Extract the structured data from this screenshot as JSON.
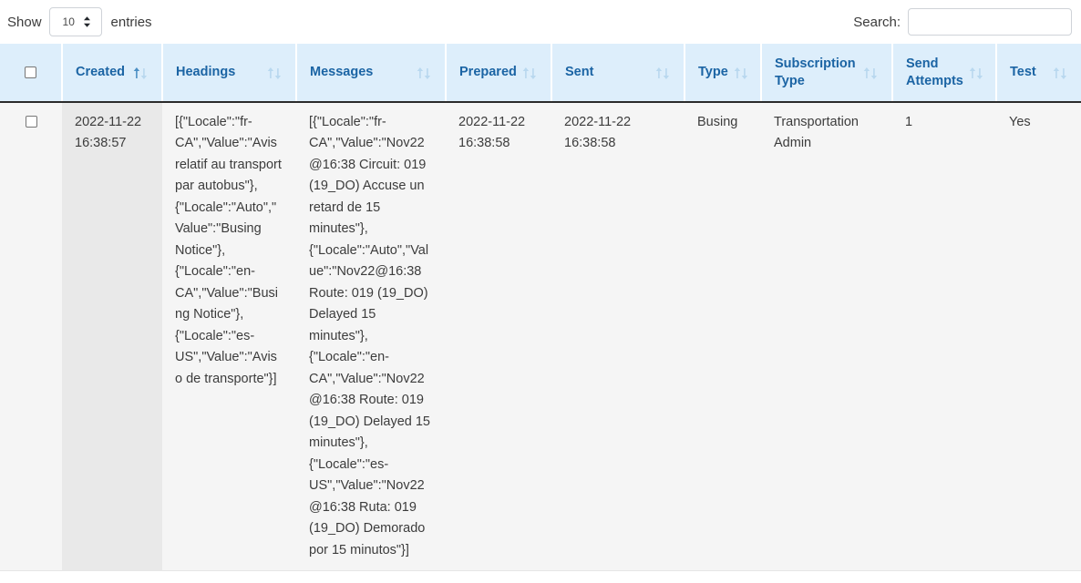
{
  "controls": {
    "show_label": "Show",
    "entries_label": "entries",
    "page_length": "10",
    "page_length_options": [
      "10",
      "25",
      "50",
      "100"
    ],
    "search_label": "Search:",
    "search_value": "",
    "search_placeholder": ""
  },
  "table": {
    "columns": [
      {
        "key": "select",
        "label": "",
        "sortable": false,
        "sorted": false
      },
      {
        "key": "created",
        "label": "Created",
        "sortable": true,
        "sorted": true
      },
      {
        "key": "headings",
        "label": "Headings",
        "sortable": true,
        "sorted": false
      },
      {
        "key": "messages",
        "label": "Messages",
        "sortable": true,
        "sorted": false
      },
      {
        "key": "prepared",
        "label": "Prepared",
        "sortable": true,
        "sorted": false
      },
      {
        "key": "sent",
        "label": "Sent",
        "sortable": true,
        "sorted": false
      },
      {
        "key": "type",
        "label": "Type",
        "sortable": true,
        "sorted": false
      },
      {
        "key": "subscription_type",
        "label": "Subscription Type",
        "sortable": true,
        "sorted": false
      },
      {
        "key": "send_attempts",
        "label": "Send Attempts",
        "sortable": true,
        "sorted": false
      },
      {
        "key": "test",
        "label": "Test",
        "sortable": true,
        "sorted": false
      }
    ],
    "rows": [
      {
        "created": "2022-11-22 16:38:57",
        "headings": "[{\"Locale\":\"fr-CA\",\"Value\":\"Avis relatif au transport par autobus\"}, {\"Locale\":\"Auto\",\"Value\":\"Busing Notice\"}, {\"Locale\":\"en-CA\",\"Value\":\"Busing Notice\"}, {\"Locale\":\"es-US\",\"Value\":\"Aviso de transporte\"}]",
        "messages": "[{\"Locale\":\"fr-CA\",\"Value\":\"Nov22@16:38 Circuit: 019 (19_DO) Accuse un retard de 15 minutes\"}, {\"Locale\":\"Auto\",\"Value\":\"Nov22@16:38 Route: 019 (19_DO) Delayed 15 minutes\"}, {\"Locale\":\"en-CA\",\"Value\":\"Nov22@16:38 Route: 019 (19_DO) Delayed 15 minutes\"}, {\"Locale\":\"es-US\",\"Value\":\"Nov22@16:38 Ruta: 019 (19_DO) Demorado por 15 minutos\"}]",
        "prepared": "2022-11-22 16:38:58",
        "sent": "2022-11-22 16:38:58",
        "type": "Busing",
        "subscription_type": "Transportation Admin",
        "send_attempts": "1",
        "test": "Yes"
      }
    ]
  },
  "colors": {
    "header_bg": "#ddeefb",
    "header_text": "#1b64a4",
    "row_bg": "#f5f5f5",
    "sorted_cell_bg": "#e9e9e9",
    "page_bg": "#ffffff",
    "border": "#2b2b2b"
  }
}
